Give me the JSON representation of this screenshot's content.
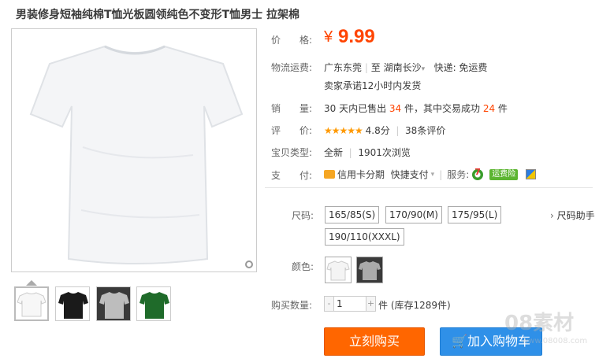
{
  "title": "男装修身短袖纯棉T恤光板圆领纯色不变形T恤男士 拉架棉",
  "price": {
    "label": "价　　格:",
    "currency": "¥",
    "value": "9.99"
  },
  "logistics": {
    "label": "物流运费:",
    "from": "广东东莞",
    "sep": "|",
    "to_label": "至",
    "to": "湖南长沙",
    "express": "快递: 免运费",
    "promise": "卖家承诺12小时内发货"
  },
  "sales": {
    "label": "销　　量:",
    "text1": "30 天内已售出 ",
    "sold": "34",
    "text2": " 件，其中交易成功 ",
    "success": "24",
    "text3": " 件"
  },
  "rating": {
    "label": "评　　价:",
    "stars": "★★★★★",
    "score": "4.8分",
    "sep": "|",
    "reviews": "38条评价"
  },
  "item_type": {
    "label": "宝贝类型:",
    "condition": "全新",
    "sep": "|",
    "views": "1901次浏览"
  },
  "payment": {
    "label": "支　　付:",
    "credit": "信用卡分期",
    "quick": "快捷支付",
    "service_label": "服务:",
    "freight_badge": "运费险"
  },
  "sizes": {
    "label": "尺码:",
    "options": [
      "165/85(S)",
      "170/90(M)",
      "175/95(L)",
      "190/110(XXXL)"
    ],
    "helper": "尺码助手"
  },
  "colors": {
    "label": "颜色:"
  },
  "quantity": {
    "label": "购买数量:",
    "minus": "-",
    "value": "1",
    "plus": "+",
    "stock": "件 (库存1289件)"
  },
  "buttons": {
    "buy": "立刻购买",
    "cart": "加入购物车"
  },
  "watermark": {
    "main": "08素材",
    "url": "www.08008.com"
  },
  "colors_hex": {
    "accent": "#ff4400",
    "buy": "#ff6600",
    "cart": "#2f90e8"
  }
}
